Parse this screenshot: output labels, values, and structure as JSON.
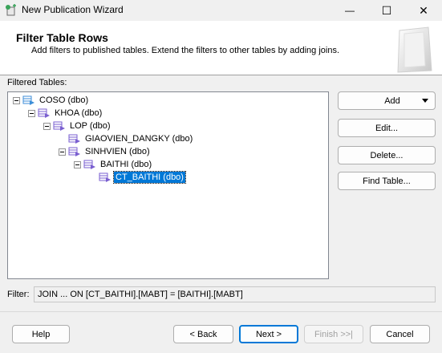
{
  "window": {
    "title": "New Publication Wizard",
    "minimize_glyph": "—",
    "maximize_glyph": "☐",
    "close_glyph": "✕"
  },
  "header": {
    "title": "Filter Table Rows",
    "subtitle": "Add filters to published tables. Extend the filters to other tables by adding joins."
  },
  "filtered_tables_label": "Filtered Tables:",
  "tree": [
    {
      "label": "COSO (dbo)",
      "depth": 0,
      "expander": true,
      "icon": "root-table-icon"
    },
    {
      "label": "KHOA (dbo)",
      "depth": 1,
      "expander": true,
      "icon": "join-table-icon"
    },
    {
      "label": "LOP (dbo)",
      "depth": 2,
      "expander": true,
      "icon": "join-table-icon"
    },
    {
      "label": "GIAOVIEN_DANGKY (dbo)",
      "depth": 3,
      "expander": false,
      "icon": "join-table-icon"
    },
    {
      "label": "SINHVIEN (dbo)",
      "depth": 3,
      "expander": true,
      "icon": "join-table-icon"
    },
    {
      "label": "BAITHI (dbo)",
      "depth": 4,
      "expander": true,
      "icon": "join-table-icon"
    },
    {
      "label": "CT_BAITHI (dbo)",
      "depth": 5,
      "expander": false,
      "icon": "join-table-icon",
      "selected": true
    }
  ],
  "side_buttons": {
    "add": "Add",
    "edit": "Edit...",
    "delete": "Delete...",
    "find_table": "Find Table..."
  },
  "filter": {
    "label": "Filter:",
    "value": "JOIN ... ON [CT_BAITHI].[MABT] = [BAITHI].[MABT]"
  },
  "footer": {
    "help": "Help",
    "back": "< Back",
    "next": "Next >",
    "finish": "Finish >>|",
    "cancel": "Cancel"
  },
  "colors": {
    "selection": "#0078d7",
    "table_icon": "#7a5fd0",
    "root_icon": "#3c8ed8"
  }
}
